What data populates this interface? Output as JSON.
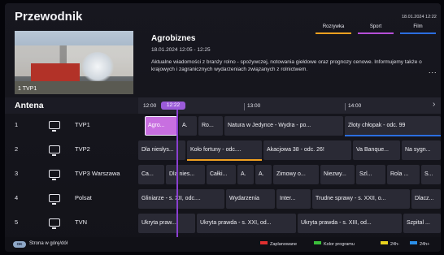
{
  "header": {
    "title": "Przewodnik",
    "date": "18.01.2024 12:22",
    "tabs": [
      {
        "label": "Rozrywka",
        "color": "#f0a020"
      },
      {
        "label": "Sport",
        "color": "#b64fd8"
      },
      {
        "label": "Film",
        "color": "#2b6ee0"
      }
    ]
  },
  "preview": {
    "channel_bug": "1 TVP1"
  },
  "program_info": {
    "title": "Agrobiznes",
    "time": "18.01.2024 12:05 - 12:25",
    "description": "Aktualne wiadomości z branży rolno - spożywczej, notowania giełdowe oraz prognozy cenowe. Informujemy także o krajowych i zagranicznych wydarzeniach związanych z rolnictwem.",
    "more": "..."
  },
  "timeline": {
    "source_label": "Antena",
    "now_label": "12:22",
    "ticks": [
      "12:00",
      "13:00",
      "14:00"
    ],
    "next_icon": "chevron-right-icon"
  },
  "channels": [
    {
      "number": "1",
      "name": "TVP1",
      "icon": "tv-icon",
      "programs": [
        "Agro...",
        "A.",
        "Ro...",
        "Natura w Jedynce - Wydra - po...",
        "Złoty chłopak - odc. 99"
      ]
    },
    {
      "number": "2",
      "name": "TVP2",
      "icon": "tv-icon",
      "programs": [
        "Dla niesłys...",
        "Koło fortuny - odc....",
        "Akacjowa 38 - odc. 26!",
        "Va Banque...",
        "Na sygn..."
      ]
    },
    {
      "number": "3",
      "name": "TVP3 Warszawa",
      "icon": "tv-icon",
      "programs": [
        "Ca...",
        "Dla nies...",
        "Całki...",
        "A.",
        "A.",
        "Zimowy o...",
        "Niezwy...",
        "Szl...",
        "Rola ...",
        "S..."
      ]
    },
    {
      "number": "4",
      "name": "Polsat",
      "icon": "tv-icon",
      "programs": [
        "Gliniarze - s. XII, odc....",
        "Wydarzenia",
        "Inter...",
        "Trudne sprawy - s. XXII, o...",
        "Dlacz..."
      ]
    },
    {
      "number": "5",
      "name": "TVN",
      "icon": "tv-icon",
      "programs": [
        "Ukryta praw...",
        "Ukryta prawda - s. XXI, od...",
        "Ukryta prawda - s. XIII, od...",
        "Szpital ..."
      ]
    }
  ],
  "footer": {
    "ok_label": "OK",
    "page_label": "Strona w górę/dół",
    "legend": [
      {
        "label": "Zaplanowane",
        "color": "#e03030"
      },
      {
        "label": "Kolor programu",
        "color": "#3bbf3b"
      },
      {
        "label": "24h-",
        "color": "#e8d21e"
      },
      {
        "label": "24h+",
        "color": "#2b8fe8"
      }
    ]
  },
  "accent": "#9b5bd9"
}
